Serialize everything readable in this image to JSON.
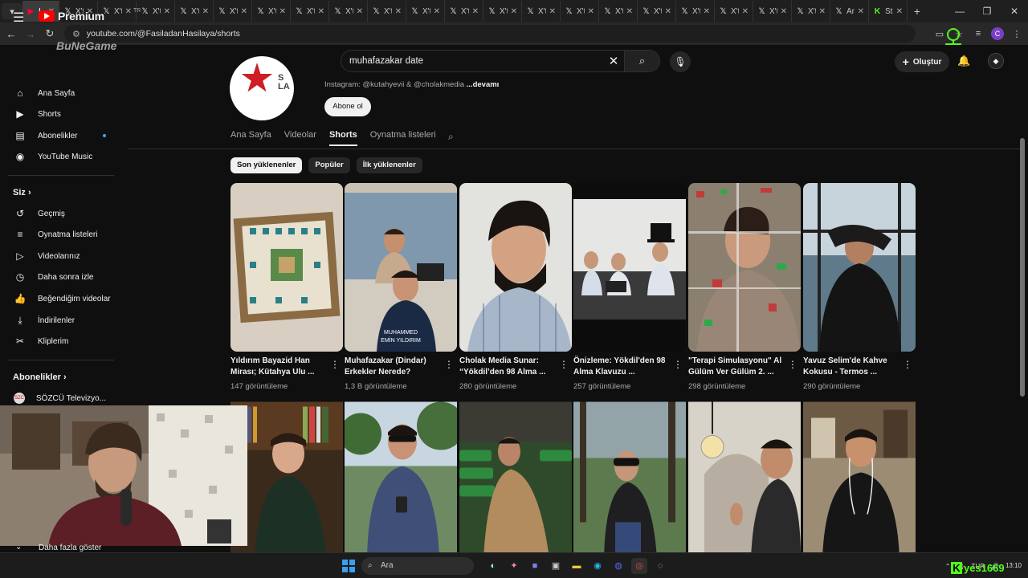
{
  "browser": {
    "tabs": [
      {
        "label": "I",
        "icon": "youtube-icon",
        "active": true
      },
      {
        "label": "X'te",
        "icon": "x-icon"
      },
      {
        "label": "X'te",
        "icon": "x-icon"
      },
      {
        "label": "X'te",
        "icon": "x-icon"
      },
      {
        "label": "X'te",
        "icon": "x-icon"
      },
      {
        "label": "X'te",
        "icon": "x-icon"
      },
      {
        "label": "X'te",
        "icon": "x-icon"
      },
      {
        "label": "X'te",
        "icon": "x-icon"
      },
      {
        "label": "X'te",
        "icon": "x-icon"
      },
      {
        "label": "X'te",
        "icon": "x-icon"
      },
      {
        "label": "X'te",
        "icon": "x-icon"
      },
      {
        "label": "X'te",
        "icon": "x-icon"
      },
      {
        "label": "X'te",
        "icon": "x-icon"
      },
      {
        "label": "X'te",
        "icon": "x-icon"
      },
      {
        "label": "X'te",
        "icon": "x-icon"
      },
      {
        "label": "X'te",
        "icon": "x-icon"
      },
      {
        "label": "X'te",
        "icon": "x-icon"
      },
      {
        "label": "X'te",
        "icon": "x-icon"
      },
      {
        "label": "X'te",
        "icon": "x-icon"
      },
      {
        "label": "X'te",
        "icon": "x-icon"
      },
      {
        "label": "X'te",
        "icon": "x-icon"
      },
      {
        "label": "Ana",
        "icon": "x-icon"
      },
      {
        "label": "Strea",
        "icon": "kick-icon"
      }
    ],
    "url": "youtube.com/@FasiladanHasilaya/shorts",
    "profile_initial": "C"
  },
  "header": {
    "logo_word": "Premium",
    "logo_region": "TR",
    "brand_overlay": "BuNeGame",
    "search_query": "muhafazakar date",
    "create_label": "Oluştur"
  },
  "sidebar": {
    "main": [
      {
        "label": "Ana Sayfa",
        "icon": "home-icon"
      },
      {
        "label": "Shorts",
        "icon": "shorts-icon"
      },
      {
        "label": "Abonelikler",
        "icon": "subscriptions-icon"
      },
      {
        "label": "YouTube Music",
        "icon": "music-icon"
      }
    ],
    "you_header": "Siz",
    "you": [
      {
        "label": "Geçmiş",
        "icon": "history-icon"
      },
      {
        "label": "Oynatma listeleri",
        "icon": "playlist-icon"
      },
      {
        "label": "Videolarınız",
        "icon": "your-videos-icon"
      },
      {
        "label": "Daha sonra izle",
        "icon": "watch-later-icon"
      },
      {
        "label": "Beğendiğim videolar",
        "icon": "thumbs-up-icon"
      },
      {
        "label": "İndirilenler",
        "icon": "download-icon"
      },
      {
        "label": "Kliplerim",
        "icon": "scissors-icon"
      }
    ],
    "subs_header": "Abonelikler",
    "subs": [
      {
        "label": "SÖZCÜ Televizyo...",
        "icon_text": "SZC"
      }
    ],
    "show_more": "Daha fazla göster"
  },
  "channel": {
    "avatar_letters": "S\nLA",
    "links_prefix": "Instagram: @kutahyevii  &  @cholakmedia",
    "links_more": "...devamı",
    "subscribe_label": "Abone ol",
    "tabs": [
      "Ana Sayfa",
      "Videolar",
      "Shorts",
      "Oynatma listeleri"
    ],
    "selected_tab": "Shorts",
    "chips": [
      "Son yüklenenler",
      "Popüler",
      "İlk yüklenenler"
    ]
  },
  "shorts": [
    {
      "title": "Yıldırım Bayazid Han Mirası; Kütahya Ulu ...",
      "views": "147 görüntüleme"
    },
    {
      "title": "Muhafazakar (Dindar) Erkekler Nerede?",
      "views": "1,3 B görüntüleme",
      "overlay": "MUHAMMED EMİN YILDIRIM"
    },
    {
      "title": "Cholak Media Sunar: “Yökdil’den 98 Alma ...",
      "views": "280 görüntüleme"
    },
    {
      "title": "Önizleme: Yökdil'den 98 Alma Klavuzu ...",
      "views": "257 görüntüleme"
    },
    {
      "title": "\"Terapi Simulasyonu\" Al Gülüm Ver Gülüm 2. ...",
      "views": "298 görüntüleme"
    },
    {
      "title": "Yavuz Selim'de Kahve Kokusu - Termos ...",
      "views": "290 görüntüleme"
    }
  ],
  "taskbar": {
    "search_label": "Ara",
    "lang": "TUR",
    "time": "13:10"
  },
  "watermark": "yes1669"
}
